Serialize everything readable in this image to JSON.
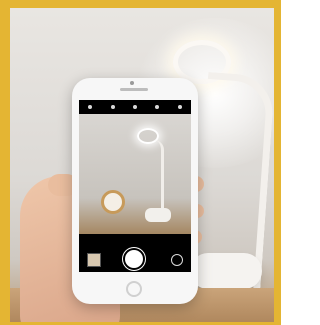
{
  "scene": {
    "subject": "",
    "camera_modes": [
      "",
      "",
      "",
      "",
      ""
    ]
  },
  "colors": {
    "frame": "#e4b533",
    "phone_body": "#f7f7f7",
    "active_mode": "#f3c200"
  },
  "icons": [
    "flash-icon",
    "hdr-icon",
    "live-photo-icon",
    "timer-icon",
    "filter-icon",
    "shutter-button",
    "camera-flip-icon",
    "home-button"
  ]
}
